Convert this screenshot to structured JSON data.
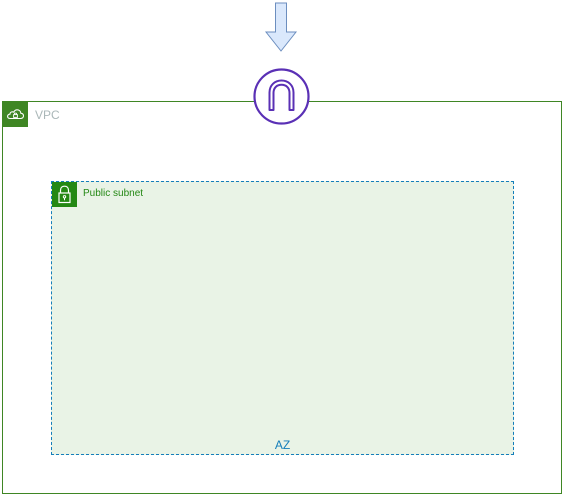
{
  "diagram": {
    "vpc": {
      "label": "VPC",
      "icon": "vpc-cloud-lock-icon",
      "color": "#3f8624"
    },
    "public_subnet": {
      "label": "Public subnet",
      "icon": "padlock-icon",
      "color": "#248814",
      "fill": "#e9f3e6"
    },
    "az": {
      "label": "AZ",
      "color": "#147eba"
    },
    "internet_gateway": {
      "icon": "internet-gateway-icon",
      "color": "#5a30b5"
    },
    "incoming_arrow": {
      "icon": "down-arrow-icon",
      "fill": "#dae8fc",
      "stroke": "#6c8ebf"
    }
  }
}
